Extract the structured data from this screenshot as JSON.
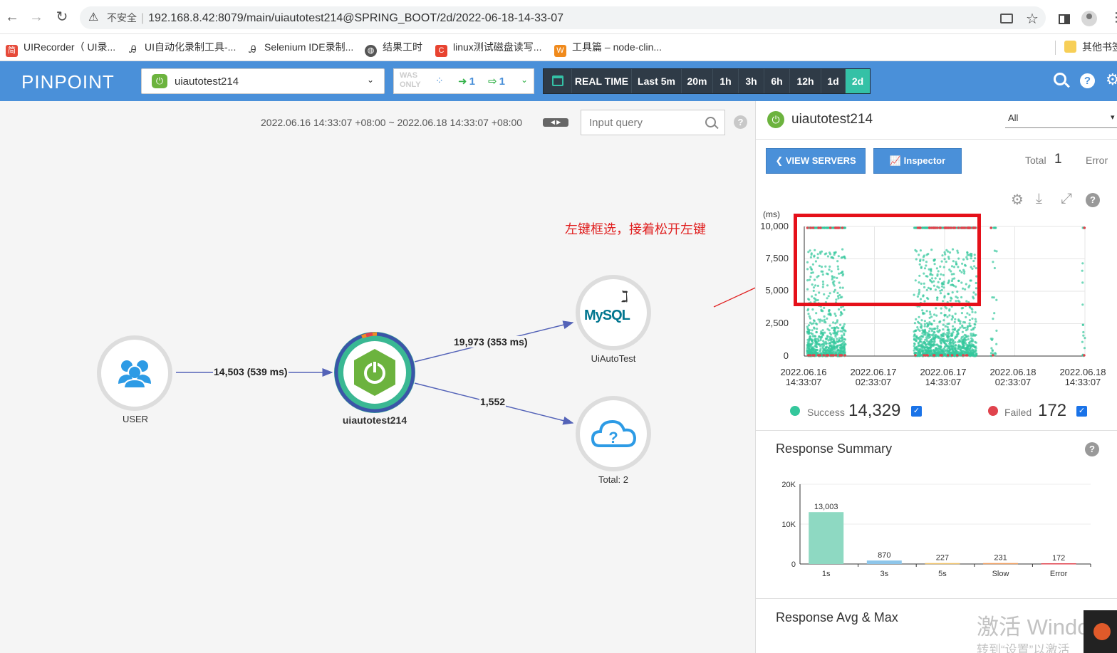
{
  "browser": {
    "url_warning": "不安全",
    "url": "192.168.8.42:8079/main/uiautotest214@SPRING_BOOT/2d/2022-06-18-14-33-07",
    "bookmarks": [
      {
        "label": "UIRecorder（ UI录...",
        "icon": "bookmark-red-icon"
      },
      {
        "label": "UI自动化录制工具-...",
        "icon": "bookmark-script-icon"
      },
      {
        "label": "Selenium IDE录制...",
        "icon": "bookmark-script-icon"
      },
      {
        "label": "结果工时",
        "icon": "globe-icon"
      },
      {
        "label": "linux测试磁盘读写...",
        "icon": "bookmark-c-icon"
      },
      {
        "label": "工具篇 – node-clin...",
        "icon": "bookmark-w-icon"
      },
      {
        "label": "其他书签",
        "icon": "folder-icon"
      }
    ]
  },
  "header": {
    "logo": "PINPOINT",
    "app_name": "uiautotest214",
    "agent_mode": "WAS ONLY",
    "agent_in": "1",
    "agent_out": "1",
    "time_buttons": [
      "REAL TIME",
      "Last 5m",
      "20m",
      "1h",
      "3h",
      "6h",
      "12h",
      "1d",
      "2d"
    ],
    "active_time": "2d"
  },
  "servermap": {
    "time_range": "2022.06.16 14:33:07 +08:00 ~ 2022.06.18 14:33:07 +08:00",
    "query_placeholder": "Input query",
    "annotation": "左键框选，接着松开左键",
    "nodes": {
      "user": "USER",
      "app": "uiautotest214",
      "mysql": "UiAutoTest",
      "mysql_logo": "MySQL",
      "unknown": "Total: 2"
    },
    "edges": {
      "user_app": "14,503 (539 ms)",
      "app_mysql": "19,973 (353 ms)",
      "app_unknown": "1,552"
    }
  },
  "panel": {
    "app_name": "uiautotest214",
    "filter_value": "All",
    "view_servers": "VIEW SERVERS",
    "inspector": "Inspector",
    "total_label": "Total",
    "total_value": "1",
    "error_label": "Error",
    "scatter": {
      "y_unit": "(ms)",
      "y_ticks": [
        "10,000",
        "7,500",
        "5,000",
        "2,500",
        "0"
      ],
      "x_ticks": [
        [
          "2022.06.16",
          "14:33:07"
        ],
        [
          "2022.06.17",
          "02:33:07"
        ],
        [
          "2022.06.17",
          "14:33:07"
        ],
        [
          "2022.06.18",
          "02:33:07"
        ],
        [
          "2022.06.18",
          "14:33:07"
        ]
      ],
      "success_label": "Success",
      "success_value": "14,329",
      "failed_label": "Failed",
      "failed_value": "172",
      "success_color": "#34c79c",
      "failed_color": "#e0434d"
    },
    "response_summary_title": "Response Summary",
    "response_avg_title": "Response Avg & Max",
    "watermark_line1": "激活 Windows",
    "watermark_line2": "转到“设置”以激活"
  },
  "chart_data": {
    "type": "bar",
    "title": "Response Summary",
    "categories": [
      "1s",
      "3s",
      "5s",
      "Slow",
      "Error"
    ],
    "values": [
      13003,
      870,
      227,
      231,
      172
    ],
    "value_labels": [
      "13,003",
      "870",
      "227",
      "231",
      "172"
    ],
    "y_ticks": [
      "20K",
      "10K",
      "0"
    ],
    "ylim": [
      0,
      20000
    ],
    "colors": [
      "#8ed9c2",
      "#8ec6ea",
      "#f0c36a",
      "#f0a060",
      "#e0434d"
    ]
  }
}
